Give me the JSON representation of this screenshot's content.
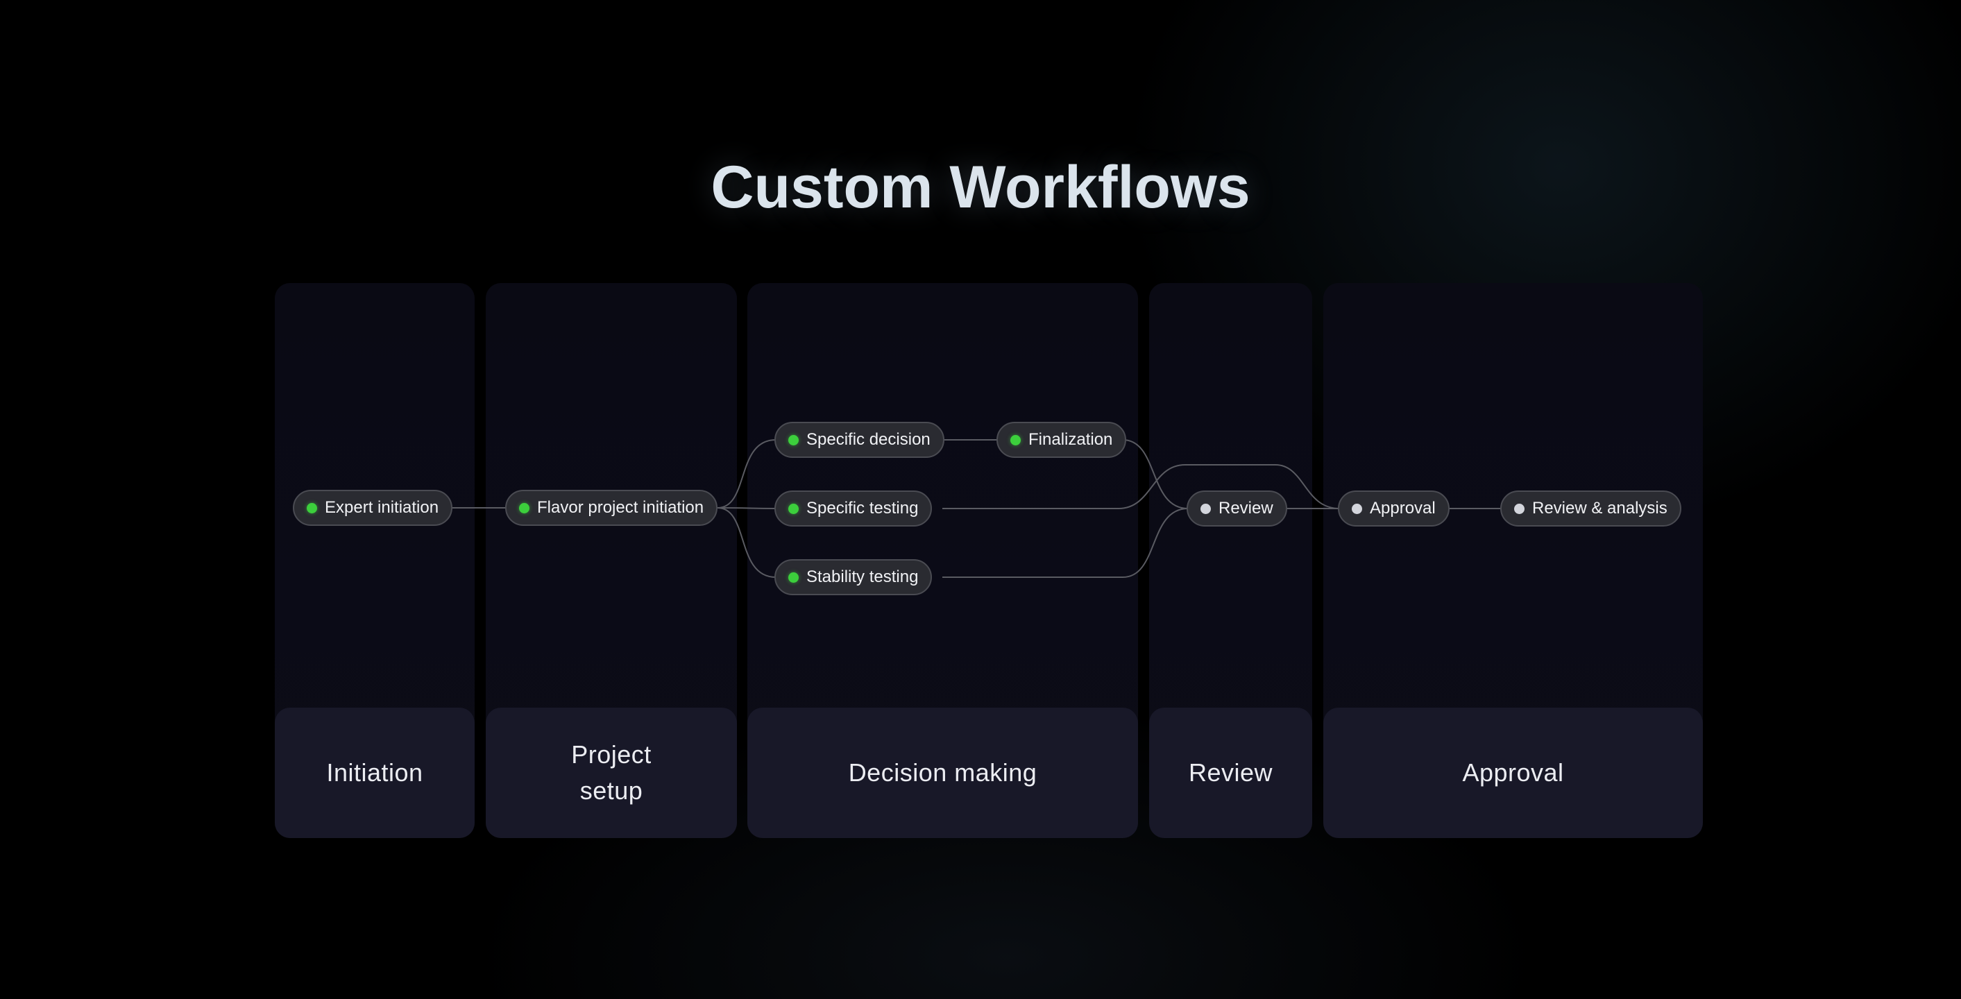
{
  "title": "Custom Workflows",
  "lanes": [
    {
      "label": "Initiation"
    },
    {
      "label": "Project setup"
    },
    {
      "label": "Decision making"
    },
    {
      "label": "Review"
    },
    {
      "label": "Approval"
    }
  ],
  "nodes": {
    "expert_initiation": {
      "label": "Expert initiation",
      "status": "active"
    },
    "flavor_project_initiation": {
      "label": "Flavor project initiation",
      "status": "active"
    },
    "specific_decision": {
      "label": "Specific decision",
      "status": "active"
    },
    "finalization": {
      "label": "Finalization",
      "status": "active"
    },
    "specific_testing": {
      "label": "Specific testing",
      "status": "active"
    },
    "stability_testing": {
      "label": "Stability testing",
      "status": "active"
    },
    "review": {
      "label": "Review",
      "status": "pending"
    },
    "approval": {
      "label": "Approval",
      "status": "pending"
    },
    "review_analysis": {
      "label": "Review & analysis",
      "status": "pending"
    }
  },
  "edges": [
    [
      "expert_initiation",
      "flavor_project_initiation"
    ],
    [
      "flavor_project_initiation",
      "specific_decision"
    ],
    [
      "flavor_project_initiation",
      "specific_testing"
    ],
    [
      "flavor_project_initiation",
      "stability_testing"
    ],
    [
      "specific_decision",
      "finalization"
    ],
    [
      "finalization",
      "review"
    ],
    [
      "specific_testing",
      "approval"
    ],
    [
      "stability_testing",
      "review"
    ],
    [
      "review",
      "approval"
    ],
    [
      "approval",
      "review_analysis"
    ]
  ],
  "colors": {
    "active": "#3ccf3c",
    "pending": "#d3d5dc",
    "wire": "#5a5b62"
  }
}
